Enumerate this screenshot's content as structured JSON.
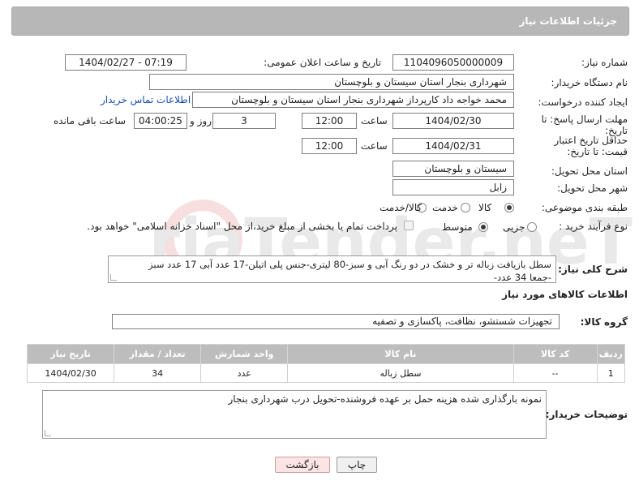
{
  "header": {
    "title": "جزئیات اطلاعات نیاز"
  },
  "form": {
    "need_number_label": "شماره نیاز:",
    "need_number": "1104096050000009",
    "announce_label": "تاریخ و ساعت اعلان عمومی:",
    "announce_value": "1404/02/27 - 07:19",
    "buyer_org_label": "نام دستگاه خریدار:",
    "buyer_org": "شهرداری بنجار استان سیستان و بلوچستان",
    "creator_label": "ایجاد کننده درخواست:",
    "creator": "محمد خواجه داد کارپرداز شهرداری بنجار استان سیستان و بلوچستان",
    "contact_link": "اطلاعات تماس خریدار",
    "deadline_label": "مهلت ارسال پاسخ: تا تاریخ:",
    "deadline_date": "1404/02/30",
    "time_label": "ساعت",
    "deadline_time": "12:00",
    "days_value": "3",
    "days_label": "روز و",
    "remaining_value": "04:00:25",
    "remaining_label": "ساعت باقی مانده",
    "validity_label": "حداقل تاریخ اعتبار قیمت: تا تاریخ:",
    "validity_date": "1404/02/31",
    "validity_time": "12:00",
    "province_label": "استان محل تحویل:",
    "province": "سیستان و بلوچستان",
    "city_label": "شهر محل تحویل:",
    "city": "زابل",
    "category_label": "طبقه بندی موضوعی:",
    "category_options": [
      "کالا",
      "خدمت",
      "کالا/خدمت"
    ],
    "process_label": "نوع فرآیند خرید :",
    "process_options": [
      "جزیی",
      "متوسط"
    ],
    "payment_note": "پرداخت تمام یا بخشی از مبلغ خرید،از محل \"اسناد خزانه اسلامی\" خواهد بود."
  },
  "summary": {
    "label": "شرح کلی نیاز:",
    "text_line1": "سطل بازیافت زباله تر و خشک در دو رنگ آبی و سبز-80 لیتری-جنس پلی اتیلن-17 عدد آبی 17 عدد سبز",
    "text_line2": "-جمعا 34 عدد-"
  },
  "goods": {
    "section_title": "اطلاعات کالاهای مورد نیاز",
    "group_label": "گروه کالا:",
    "group_value": "تجهیزات شستشو، نظافت، پاکسازی و تصفیه",
    "columns": [
      "ردیف",
      "کد کالا",
      "نام کالا",
      "واحد شمارش",
      "تعداد / مقدار",
      "تاریخ نیاز"
    ],
    "rows": [
      {
        "row": "1",
        "code": "--",
        "name": "سطل زباله",
        "unit": "عدد",
        "qty": "34",
        "date": "1404/02/30"
      }
    ]
  },
  "buyer_notes": {
    "label": "توضیحات خریدار:",
    "text": "نمونه بارگذاری شده هزینه حمل بر عهده فروشنده-تحویل درب شهرداری بنجار"
  },
  "buttons": {
    "print": "چاپ",
    "back": "بازگشت"
  },
  "watermark_text": "AriaTender.neT",
  "colors": {
    "header_bg": "#b7b7b7",
    "link": "#1a4fb0",
    "back_button_bg": "#fde4e4"
  }
}
